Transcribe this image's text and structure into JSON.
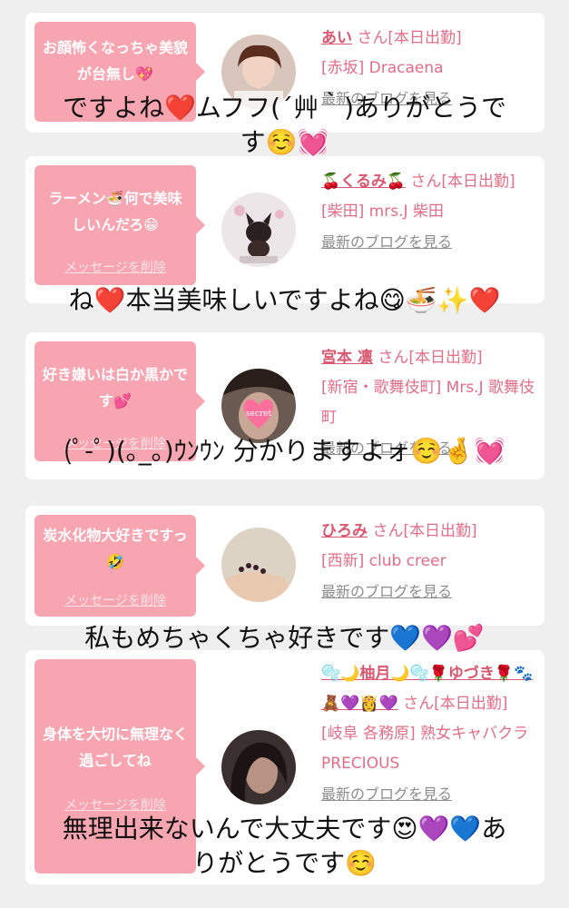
{
  "cards": [
    {
      "message": "お顔怖くなっちゃ美貌が台無し💖",
      "delete_label": "メッセージを削除",
      "name": "あい",
      "suffix": "さん[本日出勤]",
      "shop": "[赤坂] Dracaena",
      "blog": "最新のブログを見る"
    },
    {
      "message": "ラーメン🍜何で美味しいんだろ😁",
      "delete_label": "メッセージを削除",
      "name": "🍒くるみ🍒",
      "suffix": "さん[本日出勤]",
      "shop": "[柴田] mrs.J 柴田",
      "blog": "最新のブログを見る"
    },
    {
      "message": "好き嫌いは白か黒かです💕",
      "delete_label": "メッセージを削除",
      "name": "宮本 凛",
      "suffix": "さん[本日出勤]",
      "shop": "[新宿・歌舞伎町] Mrs.J 歌舞伎町",
      "blog": "最新のブログを見る",
      "avatar_text": "secret"
    },
    {
      "message": "炭水化物大好きですっ🤣",
      "delete_label": "メッセージを削除",
      "name": "ひろみ",
      "suffix": "さん[本日出勤]",
      "shop": "[西新] club creer",
      "blog": "最新のブログを見る"
    },
    {
      "message": "身体を大切に無理なく過ごしてね",
      "delete_label": "メッセージを削除",
      "name": "🫧🌙柚月🌙🫧🌹ゆづき🌹🐾🧸💜👸💜",
      "suffix": "さん[本日出勤]",
      "shop": "[岐阜 各務原] 熟女キャバクラ PRECIOUS",
      "blog": "最新のブログを見る"
    }
  ],
  "overlays": [
    "ですよね❤️ムフフ(´艸｀)ありがとうで\nす☺️💓",
    "ね❤️本当美味しいですよね😋🍜✨❤️",
    "(ﾟ-ﾟ)(｡_｡)ｳﾝｳﾝ 分かりますよォ☺️🤞💓",
    "私もめちゃくちゃ好きです💙💜💕",
    "無理出来ないんで大丈夫です😍💜💙あ\nりがとうです☺️"
  ],
  "colors": {
    "bubble": "#f8a5b2",
    "accent": "#d9576f",
    "background": "#efefef"
  }
}
